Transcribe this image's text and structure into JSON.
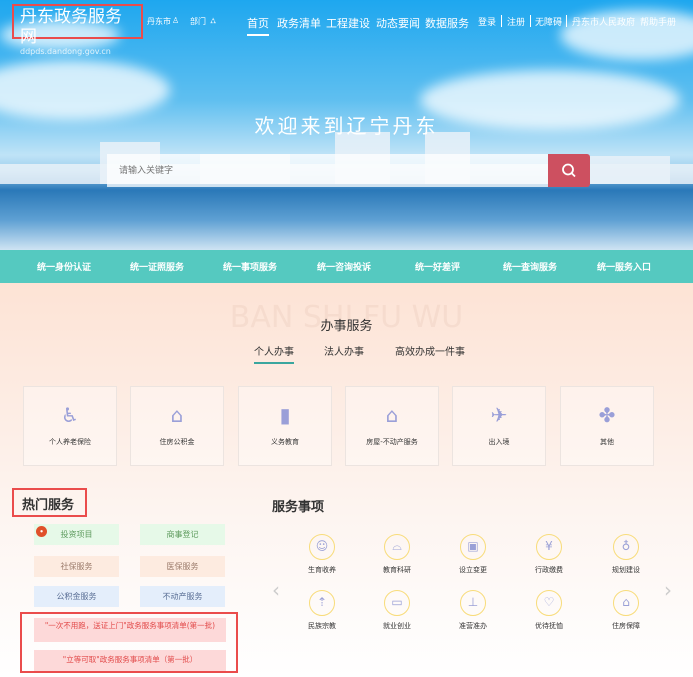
{
  "header": {
    "logo_title": "丹东政务服务网",
    "logo_sub": "ddpds.dandong.gov.cn",
    "city": "丹东市",
    "dept": "部门",
    "nav": [
      "首页",
      "政务清单",
      "工程建设",
      "动态要闻",
      "数据服务"
    ],
    "top_links": [
      "登录",
      "注册",
      "无障碍",
      "丹东市人民政府",
      "帮助手册"
    ]
  },
  "hero": {
    "welcome": "欢迎来到辽宁丹东",
    "search_placeholder": "请输入关键字"
  },
  "unified_bar": [
    "统一身份认证",
    "统一证照服务",
    "统一事项服务",
    "统一咨询投诉",
    "统一好差评",
    "统一查询服务",
    "统一服务入口"
  ],
  "office": {
    "watermark": "BAN SHI FU WU",
    "title": "办事服务",
    "tabs": [
      "个人办事",
      "法人办事",
      "高效办成一件事"
    ],
    "cards": [
      {
        "label": "个人养老保险",
        "icon": "elderly-icon"
      },
      {
        "label": "住房公积金",
        "icon": "house-icon"
      },
      {
        "label": "义务教育",
        "icon": "book-icon"
      },
      {
        "label": "房屋-不动产服务",
        "icon": "house-icon"
      },
      {
        "label": "出入境",
        "icon": "plane-icon"
      },
      {
        "label": "其他",
        "icon": "clover-icon"
      }
    ]
  },
  "hot": {
    "title": "热门服务",
    "badge": "HOT",
    "items": [
      "投资项目",
      "商事登记",
      "社保服务",
      "医保服务",
      "公积金服务",
      "不动产服务"
    ],
    "lists": [
      "\"一次不用跑，送证上门\"政务服务事项清单(第一批)",
      "\"立等可取\"政务服务事项清单（第一批）"
    ]
  },
  "matters": {
    "title": "服务事项",
    "items": [
      "生育收养",
      "教育科研",
      "设立变更",
      "行政缴费",
      "规划建设",
      "民族宗教",
      "就业创业",
      "准营准办",
      "优待抚恤",
      "住房保障"
    ]
  },
  "colors": {
    "teal": "#55c9c0",
    "red": "#ea4c4c",
    "icon": "#9a9fd8"
  }
}
